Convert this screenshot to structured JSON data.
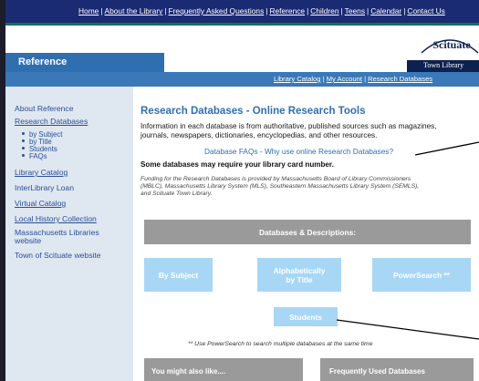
{
  "topnav": [
    "Home",
    "About the Library",
    "Frequently Asked Questions",
    "Reference",
    "Children",
    "Teens",
    "Calendar",
    "Contact Us"
  ],
  "header": {
    "section_tab": "Reference",
    "logo_text": "Scituate",
    "logo_band": "Town Library"
  },
  "subnav": [
    "Library Catalog",
    "My Account",
    "Research Databases"
  ],
  "sidebar": {
    "about": "About Reference",
    "research": "Research Databases",
    "sub_items": [
      "by Subject",
      "by Title",
      "Students",
      "FAQs"
    ],
    "library_catalog": "Library Catalog",
    "interlibrary": "InterLibrary Loan",
    "virtual_catalog": "Virtual Catalog",
    "local_history": "Local History Collection",
    "mass_libraries_1": "Massachusetts Libraries",
    "mass_libraries_2": "website",
    "town_site": "Town of Scituate website"
  },
  "main": {
    "title": "Research Databases - Online Research Tools",
    "intro_1": "Information in each database is from authoritative, published sources such as magazines,",
    "intro_2": "journals, newspapers, dictionaries, encyclopedias, and other resources.",
    "faq_link": "Database FAQs - Why use online Research Databases?",
    "card_note": "Some databases may require your library card number.",
    "funding_1": "Funding for the Research Databases is provided by Massachusetts Board of Library Commissioners",
    "funding_2": "(MBLC), Massachusetts Library System (MLS), Southeastern Massachusetts Library System (SEMLS),",
    "funding_3": "and Scituate Town Library.",
    "db_header": "Databases & Descriptions:",
    "btn_subject": "By Subject",
    "btn_alpha_1": "Alphabetically",
    "btn_alpha_2": "by Title",
    "btn_power": "PowerSearch **",
    "btn_students": "Students",
    "power_note": "** Use PowerSearch to search multiple databases at the same time",
    "might_like": "You might also like....",
    "freq_used": "Frequently Used Databases"
  },
  "colors": {
    "top_bar": "#1a2a73",
    "accent_blue": "#2f6fb0",
    "button_blue": "#a8d6f5",
    "sidebar_bg": "#dfe7f0",
    "gray_header": "#9a9a9a"
  }
}
